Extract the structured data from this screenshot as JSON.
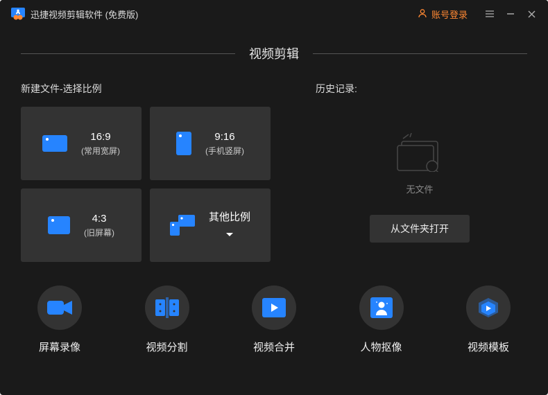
{
  "titlebar": {
    "app_title": "迅捷视频剪辑软件 (免费版)",
    "login_label": "账号登录"
  },
  "section": {
    "title": "视频剪辑",
    "new_file_label": "新建文件-选择比例",
    "history_label": "历史记录:",
    "empty_text": "无文件",
    "open_folder_label": "从文件夹打开"
  },
  "ratios": {
    "r0": {
      "big": "16:9",
      "small": "(常用宽屏)"
    },
    "r1": {
      "big": "9:16",
      "small": "(手机竖屏)"
    },
    "r2": {
      "big": "4:3",
      "small": "(旧屏幕)"
    },
    "r3": {
      "big": "其他比例"
    }
  },
  "tools": {
    "t0": "屏幕录像",
    "t1": "视频分割",
    "t2": "视频合并",
    "t3": "人物抠像",
    "t4": "视频模板"
  },
  "colors": {
    "accent_blue": "#2684ff",
    "accent_orange": "#ff8833"
  }
}
